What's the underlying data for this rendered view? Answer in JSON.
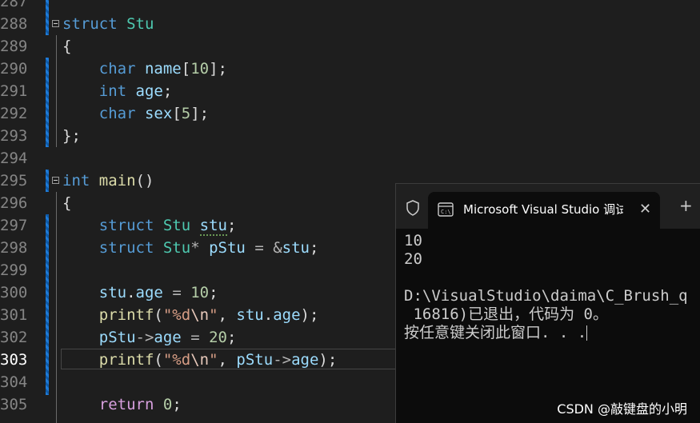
{
  "editor": {
    "lines": [
      {
        "num": "287",
        "tokens": []
      },
      {
        "num": "288",
        "tokens": [
          {
            "c": "kw",
            "t": "struct"
          },
          {
            "c": "",
            "t": " "
          },
          {
            "c": "ty",
            "t": "Stu"
          }
        ]
      },
      {
        "num": "289",
        "tokens": [
          {
            "c": "",
            "t": "{"
          }
        ]
      },
      {
        "num": "290",
        "tokens": [
          {
            "c": "",
            "t": "    "
          },
          {
            "c": "kw",
            "t": "char"
          },
          {
            "c": "",
            "t": " "
          },
          {
            "c": "var",
            "t": "name"
          },
          {
            "c": "",
            "t": "["
          },
          {
            "c": "num",
            "t": "10"
          },
          {
            "c": "",
            "t": "];"
          }
        ]
      },
      {
        "num": "291",
        "tokens": [
          {
            "c": "",
            "t": "    "
          },
          {
            "c": "kw",
            "t": "int"
          },
          {
            "c": "",
            "t": " "
          },
          {
            "c": "var",
            "t": "age"
          },
          {
            "c": "",
            "t": ";"
          }
        ]
      },
      {
        "num": "292",
        "tokens": [
          {
            "c": "",
            "t": "    "
          },
          {
            "c": "kw",
            "t": "char"
          },
          {
            "c": "",
            "t": " "
          },
          {
            "c": "var",
            "t": "sex"
          },
          {
            "c": "",
            "t": "["
          },
          {
            "c": "num",
            "t": "5"
          },
          {
            "c": "",
            "t": "];"
          }
        ]
      },
      {
        "num": "293",
        "tokens": [
          {
            "c": "",
            "t": "};"
          }
        ]
      },
      {
        "num": "294",
        "tokens": []
      },
      {
        "num": "295",
        "tokens": [
          {
            "c": "kw",
            "t": "int"
          },
          {
            "c": "",
            "t": " "
          },
          {
            "c": "fn",
            "t": "main"
          },
          {
            "c": "",
            "t": "()"
          }
        ]
      },
      {
        "num": "296",
        "tokens": [
          {
            "c": "",
            "t": "{"
          }
        ]
      },
      {
        "num": "297",
        "tokens": [
          {
            "c": "",
            "t": "    "
          },
          {
            "c": "kw",
            "t": "struct"
          },
          {
            "c": "",
            "t": " "
          },
          {
            "c": "ty",
            "t": "Stu"
          },
          {
            "c": "",
            "t": " "
          },
          {
            "c": "var squiggle",
            "t": "stu"
          },
          {
            "c": "",
            "t": ";"
          }
        ]
      },
      {
        "num": "298",
        "tokens": [
          {
            "c": "",
            "t": "    "
          },
          {
            "c": "kw",
            "t": "struct"
          },
          {
            "c": "",
            "t": " "
          },
          {
            "c": "ty",
            "t": "Stu"
          },
          {
            "c": "op",
            "t": "*"
          },
          {
            "c": "",
            "t": " "
          },
          {
            "c": "var",
            "t": "pStu"
          },
          {
            "c": "",
            "t": " "
          },
          {
            "c": "op",
            "t": "="
          },
          {
            "c": "",
            "t": " "
          },
          {
            "c": "op",
            "t": "&"
          },
          {
            "c": "var",
            "t": "stu"
          },
          {
            "c": "",
            "t": ";"
          }
        ]
      },
      {
        "num": "299",
        "tokens": []
      },
      {
        "num": "300",
        "tokens": [
          {
            "c": "",
            "t": "    "
          },
          {
            "c": "var",
            "t": "stu"
          },
          {
            "c": "",
            "t": "."
          },
          {
            "c": "var",
            "t": "age"
          },
          {
            "c": "",
            "t": " "
          },
          {
            "c": "op",
            "t": "="
          },
          {
            "c": "",
            "t": " "
          },
          {
            "c": "num",
            "t": "10"
          },
          {
            "c": "",
            "t": ";"
          }
        ]
      },
      {
        "num": "301",
        "tokens": [
          {
            "c": "",
            "t": "    "
          },
          {
            "c": "fn",
            "t": "printf"
          },
          {
            "c": "",
            "t": "("
          },
          {
            "c": "str",
            "t": "\"%d"
          },
          {
            "c": "esc",
            "t": "\\n"
          },
          {
            "c": "str",
            "t": "\""
          },
          {
            "c": "",
            "t": ", "
          },
          {
            "c": "var",
            "t": "stu"
          },
          {
            "c": "",
            "t": "."
          },
          {
            "c": "var",
            "t": "age"
          },
          {
            "c": "",
            "t": ");"
          }
        ]
      },
      {
        "num": "302",
        "tokens": [
          {
            "c": "",
            "t": "    "
          },
          {
            "c": "var",
            "t": "pStu"
          },
          {
            "c": "op",
            "t": "->"
          },
          {
            "c": "var",
            "t": "age"
          },
          {
            "c": "",
            "t": " "
          },
          {
            "c": "op",
            "t": "="
          },
          {
            "c": "",
            "t": " "
          },
          {
            "c": "num",
            "t": "20"
          },
          {
            "c": "",
            "t": ";"
          }
        ]
      },
      {
        "num": "303",
        "tokens": [
          {
            "c": "",
            "t": "    "
          },
          {
            "c": "fn",
            "t": "printf"
          },
          {
            "c": "",
            "t": "("
          },
          {
            "c": "str",
            "t": "\"%d"
          },
          {
            "c": "esc",
            "t": "\\n"
          },
          {
            "c": "str",
            "t": "\""
          },
          {
            "c": "",
            "t": ", "
          },
          {
            "c": "var",
            "t": "pStu"
          },
          {
            "c": "op",
            "t": "->"
          },
          {
            "c": "var",
            "t": "age"
          },
          {
            "c": "",
            "t": ");"
          }
        ]
      },
      {
        "num": "304",
        "tokens": []
      },
      {
        "num": "305",
        "tokens": [
          {
            "c": "",
            "t": "    "
          },
          {
            "c": "ctl",
            "t": "return"
          },
          {
            "c": "",
            "t": " "
          },
          {
            "c": "num",
            "t": "0"
          },
          {
            "c": "",
            "t": ";"
          }
        ]
      }
    ],
    "current_line": "303"
  },
  "terminal": {
    "tab_title": "Microsoft Visual Studio 调试控制台",
    "close_glyph": "✕",
    "new_tab_glyph": "+",
    "output_lines": [
      "10",
      "20",
      "",
      "D:\\VisualStudio\\daima\\C_Brush_q",
      " 16816)已退出，代码为 0。",
      "按任意键关闭此窗口. . ."
    ]
  },
  "watermark": "CSDN @敲键盘的小明",
  "colors": {
    "background": "#1e1e1e",
    "keyword": "#569cd6",
    "type": "#4ec9b0",
    "function": "#dcdcaa",
    "variable": "#9cdcfe",
    "number": "#b5cea8",
    "string": "#d69d85",
    "terminal_bg": "#0c0c0c"
  }
}
